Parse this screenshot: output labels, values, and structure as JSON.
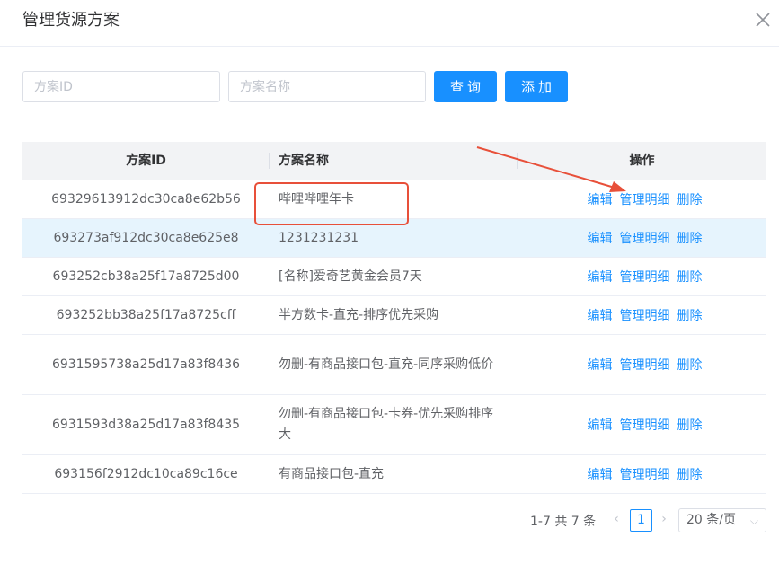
{
  "dialog": {
    "title": "管理货源方案"
  },
  "toolbar": {
    "id_placeholder": "方案ID",
    "name_placeholder": "方案名称",
    "search_label": "查询",
    "add_label": "添加"
  },
  "table": {
    "headers": {
      "id": "方案ID",
      "name": "方案名称",
      "ops": "操作"
    },
    "rows": [
      {
        "id": "69329613912dc30ca8e62b56",
        "name": "哔哩哔哩年卡",
        "highlighted": false
      },
      {
        "id": "693273af912dc30ca8e625e8",
        "name": "1231231231",
        "highlighted": true
      },
      {
        "id": "693252cb38a25f17a8725d00",
        "name": "[名称]爱奇艺黄金会员7天",
        "highlighted": false
      },
      {
        "id": "693252bb38a25f17a8725cff",
        "name": "半方数卡-直充-排序优先采购",
        "highlighted": false
      },
      {
        "id": "6931595738a25d17a83f8436",
        "name": "勿删-有商品接口包-直充-同序采购低价",
        "highlighted": false
      },
      {
        "id": "6931593d38a25d17a83f8435",
        "name": "勿删-有商品接口包-卡券-优先采购排序大",
        "highlighted": false
      },
      {
        "id": "693156f2912dc10ca89c16ce",
        "name": "有商品接口包-直充",
        "highlighted": false
      }
    ],
    "actions": {
      "edit": "编辑",
      "manage": "管理明细",
      "delete": "删除"
    }
  },
  "pagination": {
    "total_text": "1-7 共 7 条",
    "current_page": "1",
    "page_size": "20 条/页"
  },
  "annotation": {
    "color": "#e8503a"
  },
  "colors": {
    "accent": "#1890ff",
    "highlight_row": "#e6f4fd",
    "header_bg": "#f2f3f5"
  }
}
